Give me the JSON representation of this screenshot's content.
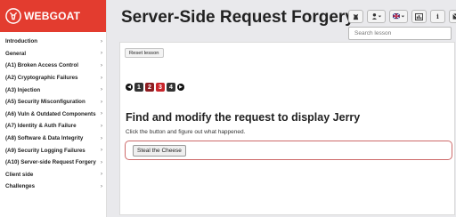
{
  "brand": {
    "name": "WEBGOAT"
  },
  "page_title": "Server-Side Request Forgery",
  "search": {
    "placeholder": "Search lesson"
  },
  "toolbar": {
    "buttons": [
      {
        "icon": "goat-icon"
      },
      {
        "icon": "user-menu-icon"
      },
      {
        "icon": "language-flag-icon"
      },
      {
        "icon": "report-card-icon"
      },
      {
        "icon": "info-icon"
      },
      {
        "icon": "mail-icon"
      }
    ]
  },
  "sidebar": {
    "items": [
      {
        "label": "Introduction"
      },
      {
        "label": "General"
      },
      {
        "label": "(A1) Broken Access Control"
      },
      {
        "label": "(A2) Cryptographic Failures"
      },
      {
        "label": "(A3) Injection"
      },
      {
        "label": "(A5) Security Misconfiguration"
      },
      {
        "label": "(A6) Vuln & Outdated Components"
      },
      {
        "label": "(A7) Identity & Auth Failure"
      },
      {
        "label": "(A8) Software & Data Integrity"
      },
      {
        "label": "(A9) Security Logging Failures"
      },
      {
        "label": "(A10) Server-side Request Forgery"
      },
      {
        "label": "Client side"
      },
      {
        "label": "Challenges"
      }
    ]
  },
  "lesson": {
    "reset_label": "Reset lesson",
    "pages": [
      "1",
      "2",
      "3",
      "4"
    ],
    "current_page": "2",
    "heading": "Find and modify the request to display Jerry",
    "description": "Click the button and figure out what happened.",
    "button_label": "Steal the Cheese"
  },
  "colors": {
    "brand": "#e33c2f",
    "accent_red": "#c9252b"
  }
}
